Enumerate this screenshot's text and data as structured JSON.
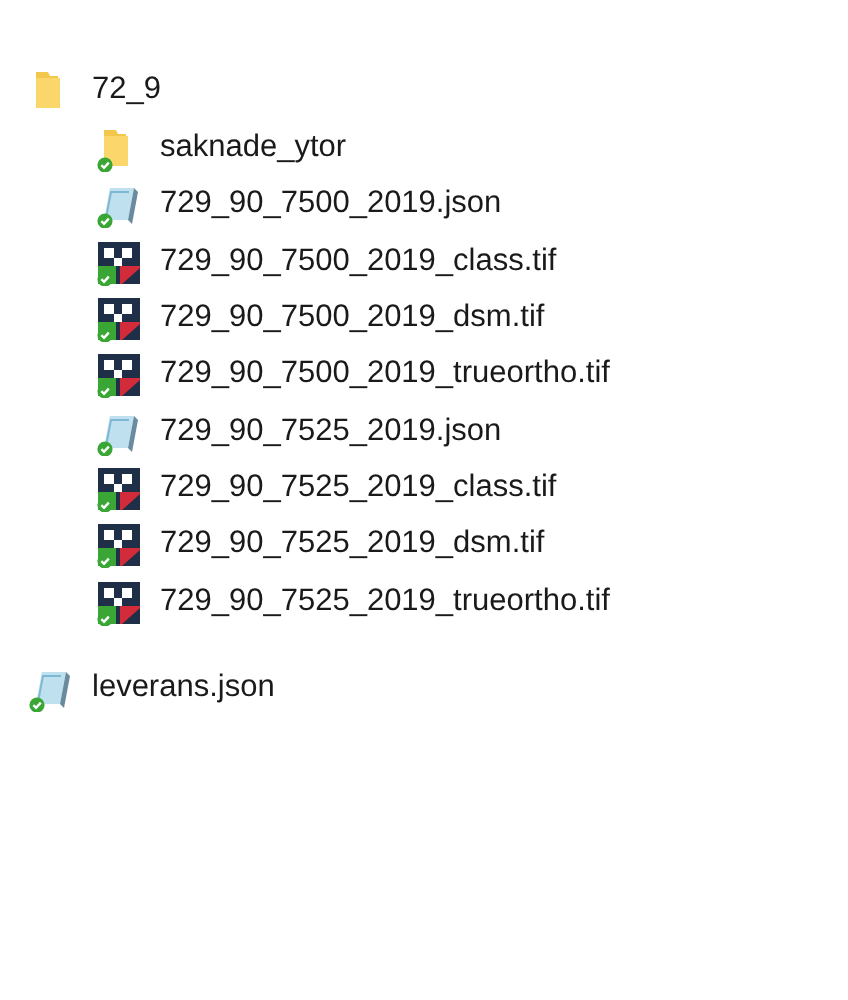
{
  "tree": [
    {
      "kind": "folder",
      "name": "72_9",
      "synced": false,
      "children": [
        {
          "kind": "folder",
          "name": "saknade_ytor",
          "synced": true
        },
        {
          "kind": "json",
          "name": "729_90_7500_2019.json",
          "synced": true
        },
        {
          "kind": "tif",
          "name": "729_90_7500_2019_class.tif",
          "synced": true
        },
        {
          "kind": "tif",
          "name": "729_90_7500_2019_dsm.tif",
          "synced": true
        },
        {
          "kind": "tif",
          "name": "729_90_7500_2019_trueortho.tif",
          "synced": true
        },
        {
          "kind": "json",
          "name": "729_90_7525_2019.json",
          "synced": true
        },
        {
          "kind": "tif",
          "name": "729_90_7525_2019_class.tif",
          "synced": true
        },
        {
          "kind": "tif",
          "name": "729_90_7525_2019_dsm.tif",
          "synced": true
        },
        {
          "kind": "tif",
          "name": "729_90_7525_2019_trueortho.tif",
          "synced": true
        }
      ]
    },
    {
      "kind": "json",
      "name": "leverans.json",
      "synced": true
    }
  ]
}
